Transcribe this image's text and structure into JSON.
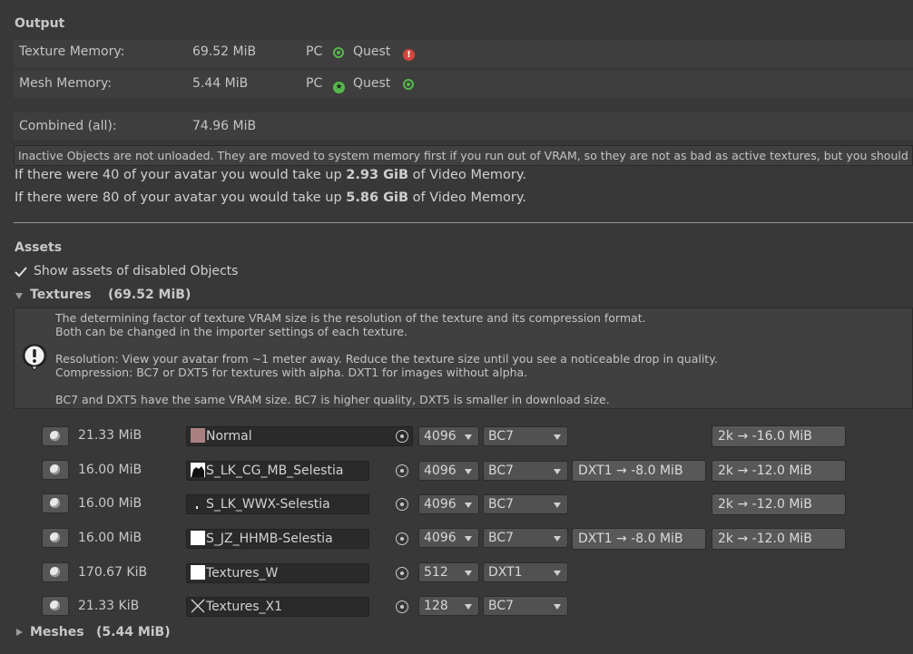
{
  "output": {
    "title": "Output",
    "texture_memory": {
      "label": "Texture Memory:",
      "value": "69.52 MiB",
      "pc": "PC",
      "quest": "Quest"
    },
    "mesh_memory": {
      "label": "Mesh Memory:",
      "value": "5.44 MiB",
      "pc": "PC",
      "quest": "Quest"
    },
    "combined": {
      "label": "Combined (all):",
      "value": "74.96 MiB"
    },
    "inactive_note": "Inactive Objects are not unloaded. They are moved to system memory first if you run out of VRAM, so they are not as bad as active textures, but you should s",
    "avatar40": {
      "pre": "If there were 40 of your avatar you would take up ",
      "value": "2.93 GiB",
      "post": " of Video Memory."
    },
    "avatar80": {
      "pre": "If there were 80 of your avatar you would take up ",
      "value": "5.86 GiB",
      "post": " of Video Memory."
    }
  },
  "assets": {
    "title": "Assets",
    "show_disabled_label": "Show assets of disabled Objects",
    "show_disabled_checked": true,
    "textures_label": "Textures",
    "textures_total": "(69.52 MiB)",
    "help": {
      "line1": "The determining factor of texture VRAM size is the resolution of the texture and its compression format.",
      "line2": "Both can be changed in the importer settings of each texture.",
      "line3": "Resolution: View your avatar from ~1 meter away. Reduce the texture size until you see a noticeable drop in quality.",
      "line4": "Compression: BC7 or DXT5 for textures with alpha. DXT1 for images without alpha.",
      "line5": "BC7 and DXT5 have the same VRAM size. BC7 is higher quality, DXT5 is smaller in download size."
    },
    "textures": [
      {
        "size": "21.33 MiB",
        "name": "Normal",
        "resolution": "4096",
        "format": "BC7",
        "compress_suggestion": "",
        "resize_suggestion": "2k → -16.0 MiB"
      },
      {
        "size": "16.00 MiB",
        "name": "S_LK_CG_MB_Selestia",
        "resolution": "4096",
        "format": "BC7",
        "compress_suggestion": "DXT1 → -8.0 MiB",
        "resize_suggestion": "2k → -12.0 MiB"
      },
      {
        "size": "16.00 MiB",
        "name": "S_LK_WWX-Selestia",
        "resolution": "4096",
        "format": "BC7",
        "compress_suggestion": "",
        "resize_suggestion": "2k → -12.0 MiB"
      },
      {
        "size": "16.00 MiB",
        "name": "S_JZ_HHMB-Selestia",
        "resolution": "4096",
        "format": "BC7",
        "compress_suggestion": "DXT1 → -8.0 MiB",
        "resize_suggestion": "2k → -12.0 MiB"
      },
      {
        "size": "170.67 KiB",
        "name": "Textures_W",
        "resolution": "512",
        "format": "DXT1",
        "compress_suggestion": "",
        "resize_suggestion": ""
      },
      {
        "size": "21.33 KiB",
        "name": "Textures_X1",
        "resolution": "128",
        "format": "BC7",
        "compress_suggestion": "",
        "resize_suggestion": ""
      }
    ],
    "meshes_label": "Meshes",
    "meshes_total": "(5.44 MiB)"
  },
  "colors": {
    "background": "#383838",
    "ok_status": "#56b84c",
    "error_status": "#d3463c"
  }
}
